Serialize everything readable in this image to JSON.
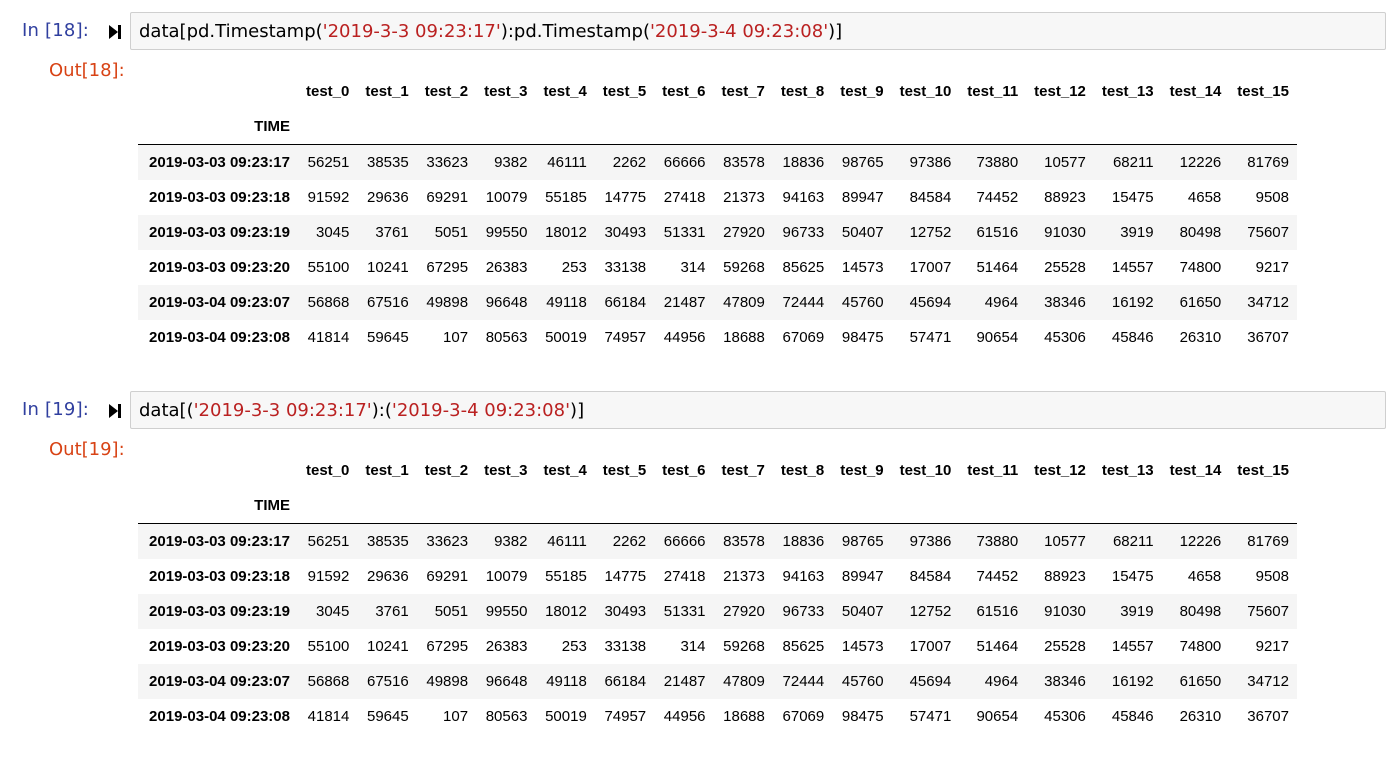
{
  "columns": [
    "test_0",
    "test_1",
    "test_2",
    "test_3",
    "test_4",
    "test_5",
    "test_6",
    "test_7",
    "test_8",
    "test_9",
    "test_10",
    "test_11",
    "test_12",
    "test_13",
    "test_14",
    "test_15"
  ],
  "index_name": "TIME",
  "cells": [
    {
      "in_prompt": "In [18]:",
      "out_prompt": "Out[18]:",
      "code": [
        {
          "t": "plain",
          "s": "data[pd.Timestamp("
        },
        {
          "t": "str",
          "s": "'2019-3-3 09:23:17'"
        },
        {
          "t": "plain",
          "s": "):pd.Timestamp("
        },
        {
          "t": "str",
          "s": "'2019-3-4 09:23:08'"
        },
        {
          "t": "plain",
          "s": ")]"
        }
      ]
    },
    {
      "in_prompt": "In [19]:",
      "out_prompt": "Out[19]:",
      "code": [
        {
          "t": "plain",
          "s": "data[("
        },
        {
          "t": "str",
          "s": "'2019-3-3 09:23:17'"
        },
        {
          "t": "plain",
          "s": "):("
        },
        {
          "t": "str",
          "s": "'2019-3-4 09:23:08'"
        },
        {
          "t": "plain",
          "s": ")]"
        }
      ]
    }
  ],
  "rows": [
    {
      "index": "2019-03-03 09:23:17",
      "values": [
        56251,
        38535,
        33623,
        9382,
        46111,
        2262,
        66666,
        83578,
        18836,
        98765,
        97386,
        73880,
        10577,
        68211,
        12226,
        81769
      ]
    },
    {
      "index": "2019-03-03 09:23:18",
      "values": [
        91592,
        29636,
        69291,
        10079,
        55185,
        14775,
        27418,
        21373,
        94163,
        89947,
        84584,
        74452,
        88923,
        15475,
        4658,
        9508
      ]
    },
    {
      "index": "2019-03-03 09:23:19",
      "values": [
        3045,
        3761,
        5051,
        99550,
        18012,
        30493,
        51331,
        27920,
        96733,
        50407,
        12752,
        61516,
        91030,
        3919,
        80498,
        75607
      ]
    },
    {
      "index": "2019-03-03 09:23:20",
      "values": [
        55100,
        10241,
        67295,
        26383,
        253,
        33138,
        314,
        59268,
        85625,
        14573,
        17007,
        51464,
        25528,
        14557,
        74800,
        9217
      ]
    },
    {
      "index": "2019-03-04 09:23:07",
      "values": [
        56868,
        67516,
        49898,
        96648,
        49118,
        66184,
        21487,
        47809,
        72444,
        45760,
        45694,
        4964,
        38346,
        16192,
        61650,
        34712
      ]
    },
    {
      "index": "2019-03-04 09:23:08",
      "values": [
        41814,
        59645,
        107,
        80563,
        50019,
        74957,
        44956,
        18688,
        67069,
        98475,
        57471,
        90654,
        45306,
        45846,
        26310,
        36707
      ]
    }
  ]
}
